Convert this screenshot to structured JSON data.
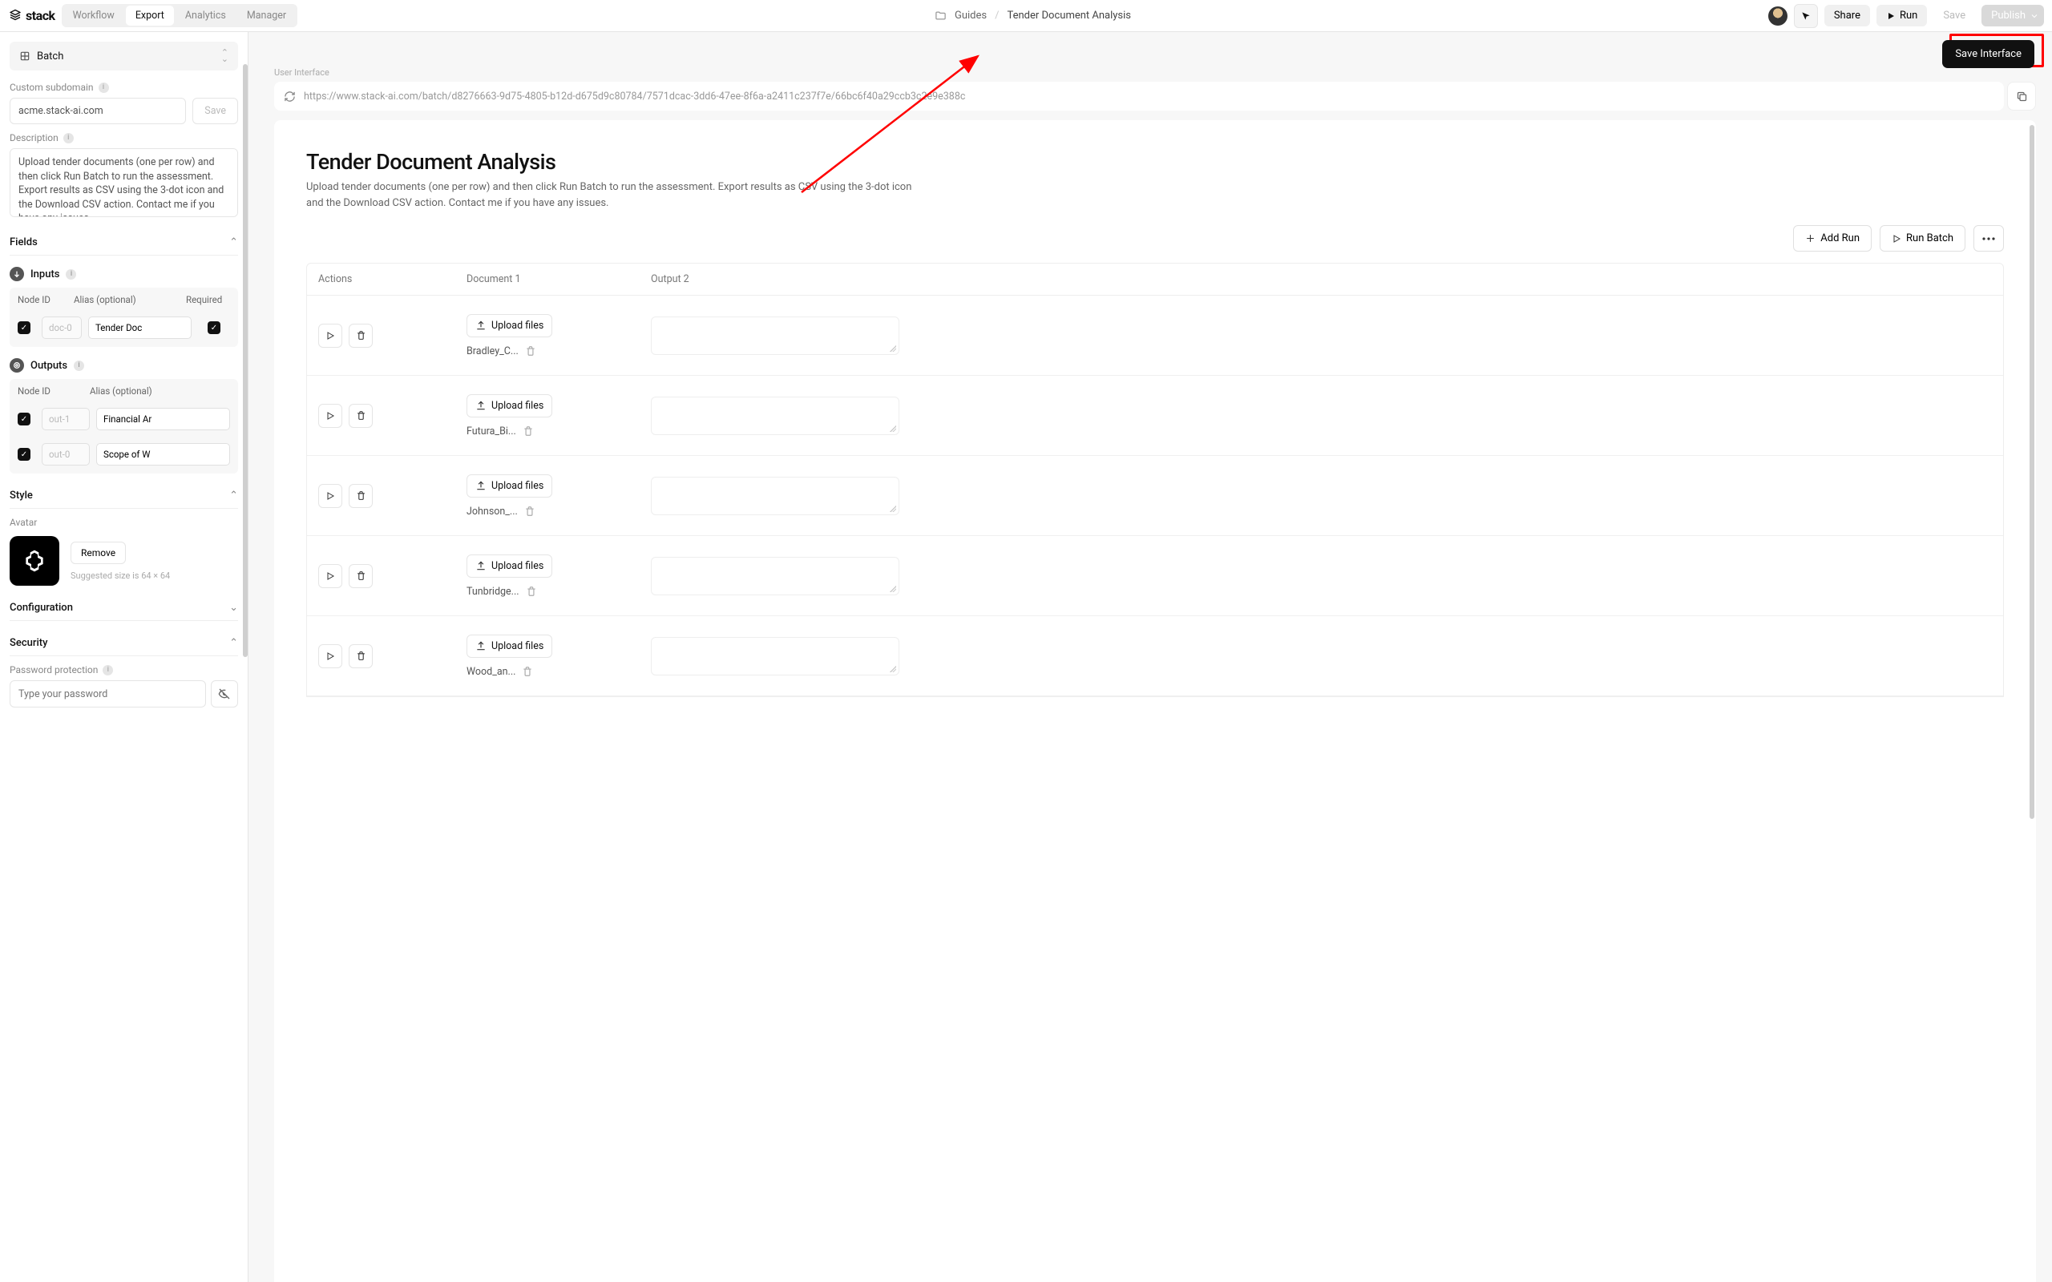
{
  "topbar": {
    "logo": "stack",
    "tabs": {
      "workflow": "Workflow",
      "export": "Export",
      "analytics": "Analytics",
      "manager": "Manager"
    },
    "breadcrumb_root": "Guides",
    "breadcrumb_page": "Tender Document Analysis",
    "share": "Share",
    "run": "Run",
    "save": "Save",
    "publish": "Publish"
  },
  "sidebar": {
    "selector_label": "Batch",
    "subdomain_label": "Custom subdomain",
    "subdomain_value": "acme.stack-ai.com",
    "subdomain_save": "Save",
    "description_label": "Description",
    "description_value": "Upload tender documents (one per row) and then click Run Batch to run the assessment. Export results as CSV using the 3-dot icon and the Download CSV action. Contact me if you have any issues.",
    "fields_label": "Fields",
    "inputs_label": "Inputs",
    "outputs_label": "Outputs",
    "col_nodeid": "Node ID",
    "col_alias": "Alias (optional)",
    "col_required": "Required",
    "inputs": [
      {
        "node": "doc-0",
        "alias": "Tender Doc"
      }
    ],
    "outputs": [
      {
        "node": "out-1",
        "alias": "Financial Ar"
      },
      {
        "node": "out-0",
        "alias": "Scope of W"
      }
    ],
    "style_label": "Style",
    "avatar_label": "Avatar",
    "remove": "Remove",
    "avatar_hint": "Suggested size is 64 × 64",
    "configuration_label": "Configuration",
    "security_label": "Security",
    "pw_label": "Password protection",
    "pw_placeholder": "Type your password"
  },
  "main": {
    "save_interface": "Save Interface",
    "panel_label": "User Interface",
    "url": "https://www.stack-ai.com/batch/d8276663-9d75-4805-b12d-d675d9c80784/7571dcac-3dd6-47ee-8f6a-a2411c237f7e/66bc6f40a29ccb3c2e9e388c",
    "title": "Tender Document Analysis",
    "desc": "Upload tender documents (one per row) and then click Run Batch to run the assessment. Export results as CSV using the 3-dot icon and the Download CSV action. Contact me if you have any issues.",
    "add_run": "Add Run",
    "run_batch": "Run Batch",
    "col_actions": "Actions",
    "col_doc": "Document 1",
    "col_out": "Output 2",
    "upload": "Upload files",
    "rows": [
      {
        "file": "Bradley_C..."
      },
      {
        "file": "Futura_Bi..."
      },
      {
        "file": "Johnson_..."
      },
      {
        "file": "Tunbridge..."
      },
      {
        "file": "Wood_an..."
      }
    ]
  }
}
